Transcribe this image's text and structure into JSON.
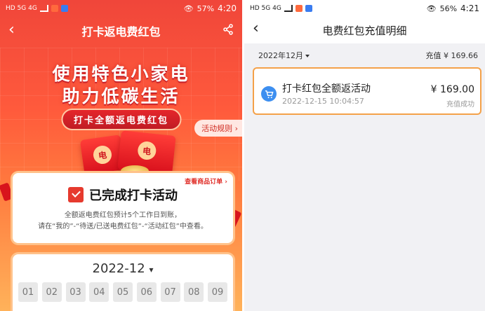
{
  "left": {
    "status": {
      "network": "HD 5G 4G",
      "battery": "57%",
      "time": "4:20"
    },
    "nav": {
      "title": "打卡返电费红包"
    },
    "hero": {
      "line1": "使用特色小家电",
      "line2": "助力低碳生活",
      "tag": "打卡全额返电费红包",
      "rules": "活动规则",
      "envelope_char": "电"
    },
    "done_card": {
      "order_link": "查看商品订单",
      "status_text": "已完成打卡活动",
      "note_line1": "全额返电费红包预计5个工作日到账，",
      "note_line2": "请在“我的”-“待送/已送电费红包”-“活动红包”中查看。"
    },
    "calendar": {
      "month": "2022-12",
      "days": [
        "01",
        "02",
        "03",
        "04",
        "05",
        "06",
        "07",
        "08",
        "09"
      ]
    }
  },
  "right": {
    "status": {
      "network": "HD 5G 4G",
      "battery": "56%",
      "time": "4:21"
    },
    "nav": {
      "title": "电费红包充值明细"
    },
    "summary": {
      "month": "2022年12月",
      "total": "充值 ¥ 169.66"
    },
    "records": [
      {
        "title": "打卡红包全额返活动",
        "time": "2022-12-15 10:04:57",
        "amount": "¥ 169.00",
        "status": "充值成功"
      }
    ]
  },
  "colors": {
    "primary_red": "#e63a2e",
    "highlight_border": "#f4a149",
    "cart_icon_blue": "#3d8ff0"
  },
  "icons": [
    "back-arrow-icon",
    "share-icon",
    "calendar-check-icon",
    "cart-icon",
    "dropdown-caret-icon"
  ]
}
